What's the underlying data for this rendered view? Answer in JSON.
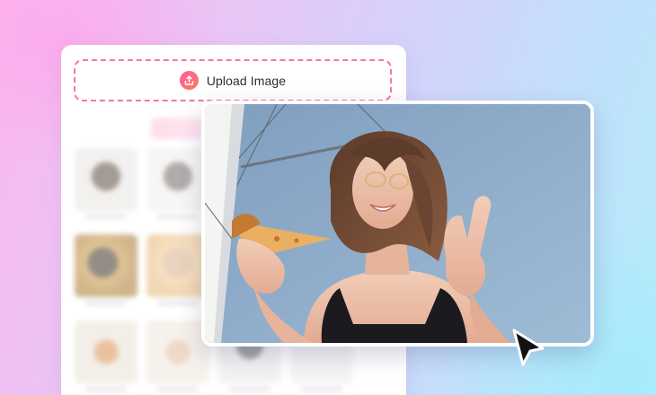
{
  "upload": {
    "label": "Upload Image",
    "icon": "upload-arrow-icon"
  },
  "categories": {
    "active_index": 2,
    "count": 4
  },
  "gallery": {
    "thumb_count": 12
  },
  "photo": {
    "alt_description": ""
  },
  "cursor": {
    "icon": "pointer-arrow-icon"
  },
  "colors": {
    "accent_pink": "#ef7aa3",
    "gradient_start": "#ff5aa8",
    "gradient_end": "#ff7b55"
  }
}
